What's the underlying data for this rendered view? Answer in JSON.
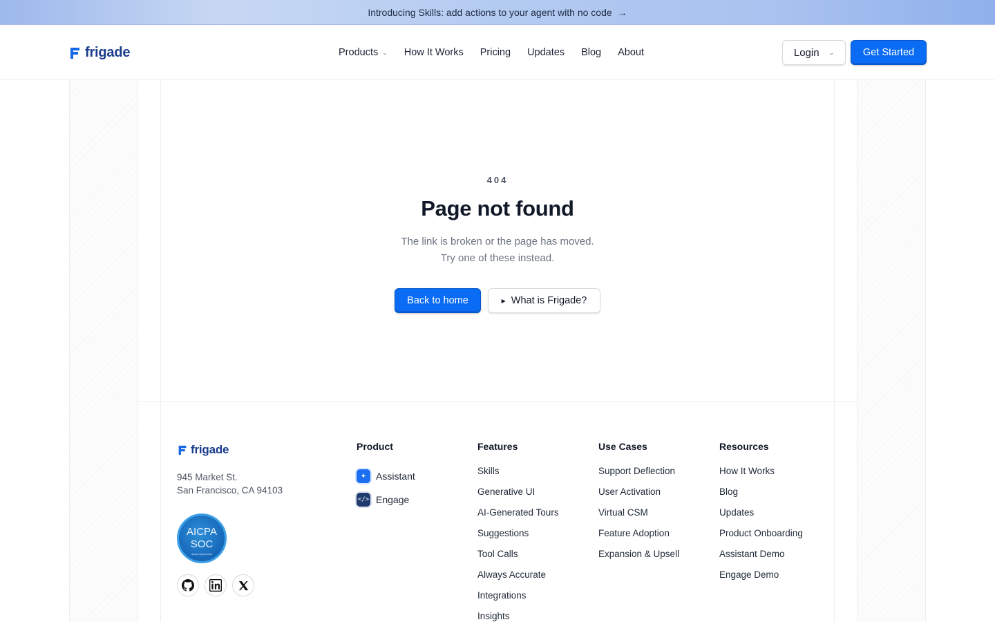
{
  "banner": {
    "text": "Introducing Skills: add actions to your agent with no code",
    "arrow": "→"
  },
  "header": {
    "logo_text": "frigade",
    "nav": [
      {
        "label": "Products",
        "has_dropdown": true
      },
      {
        "label": "How It Works"
      },
      {
        "label": "Pricing"
      },
      {
        "label": "Updates"
      },
      {
        "label": "Blog"
      },
      {
        "label": "About"
      }
    ],
    "login_label": "Login",
    "cta_label": "Get Started"
  },
  "hero": {
    "code": "404",
    "title": "Page not found",
    "description": "The link is broken or the page has moved. Try one of these instead.",
    "primary_button": "Back to home",
    "secondary_button": "What is Frigade?"
  },
  "footer": {
    "logo_text": "frigade",
    "address_line1": "945 Market St.",
    "address_line2": "San Francisco, CA 94103",
    "badge": {
      "line1": "AICPA",
      "line2": "SOC",
      "line3": "aicpa.org/soc4so"
    },
    "social": [
      "github-icon",
      "linkedin-icon",
      "x-icon"
    ],
    "product": {
      "title": "Product",
      "items": [
        {
          "label": "Assistant",
          "icon": "sparkle-icon"
        },
        {
          "label": "Engage",
          "icon": "code-icon"
        }
      ]
    },
    "features": {
      "title": "Features",
      "items": [
        "Skills",
        "Generative UI",
        "AI-Generated Tours",
        "Suggestions",
        "Tool Calls",
        "Always Accurate",
        "Integrations",
        "Insights"
      ]
    },
    "use_cases": {
      "title": "Use Cases",
      "items": [
        "Support Deflection",
        "User Activation",
        "Virtual CSM",
        "Feature Adoption",
        "Expansion & Upsell"
      ]
    },
    "resources": {
      "title": "Resources",
      "items": [
        "How It Works",
        "Blog",
        "Updates",
        "Product Onboarding",
        "Assistant Demo",
        "Engage Demo"
      ]
    }
  },
  "colors": {
    "brand_blue": "#0a6cf5",
    "logo_navy": "#1a3c8c"
  }
}
